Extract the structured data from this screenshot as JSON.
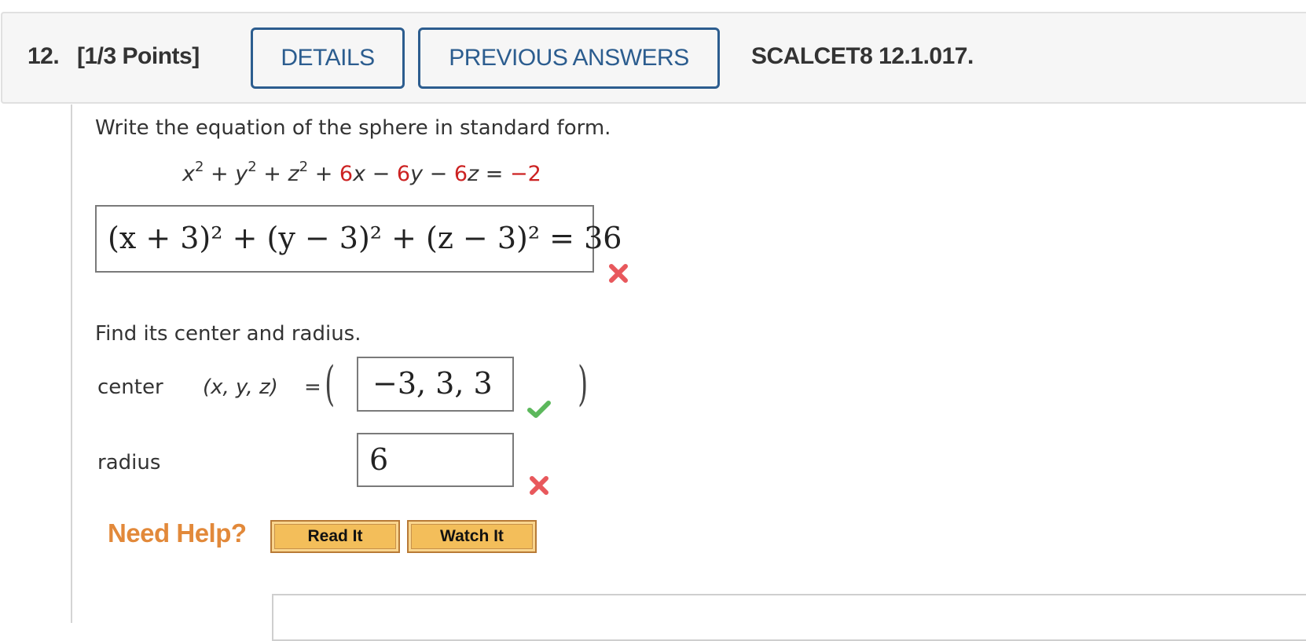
{
  "header": {
    "question_number": "12.",
    "points": "[1/3 Points]",
    "details_label": "DETAILS",
    "previous_answers_label": "PREVIOUS ANSWERS",
    "question_code": "SCALCET8 12.1.017."
  },
  "question": {
    "prompt": "Write the equation of the sphere in standard form.",
    "given_equation": {
      "terms": [
        "x",
        "2",
        " + ",
        "y",
        "2",
        " + ",
        "z",
        "2",
        " + ",
        "6",
        "x",
        " − ",
        "6",
        "y",
        " − ",
        "6",
        "z",
        " = ",
        "−2"
      ]
    },
    "standard_form_answer": {
      "value": "(x + 3)² + (y − 3)² + (z − 3)² = 36",
      "status": "incorrect"
    },
    "find_prompt": "Find its center and radius.",
    "center": {
      "label": "center",
      "coord_label": "(x, y, z)",
      "equals": "=",
      "open_paren": "(",
      "close_paren": ")",
      "value": "−3, 3, 3",
      "status": "correct"
    },
    "radius": {
      "label": "radius",
      "value": "6",
      "status": "incorrect"
    }
  },
  "help": {
    "label": "Need Help?",
    "read_it_label": "Read It",
    "watch_it_label": "Watch It"
  },
  "colors": {
    "accent_blue": "#2c5d8f",
    "given_red": "#cc2222",
    "help_orange": "#e2893a",
    "correct_green": "#5cb85c",
    "incorrect_red": "#e8585c"
  },
  "icons": {
    "incorrect": "x-mark-icon",
    "correct": "check-mark-icon"
  }
}
